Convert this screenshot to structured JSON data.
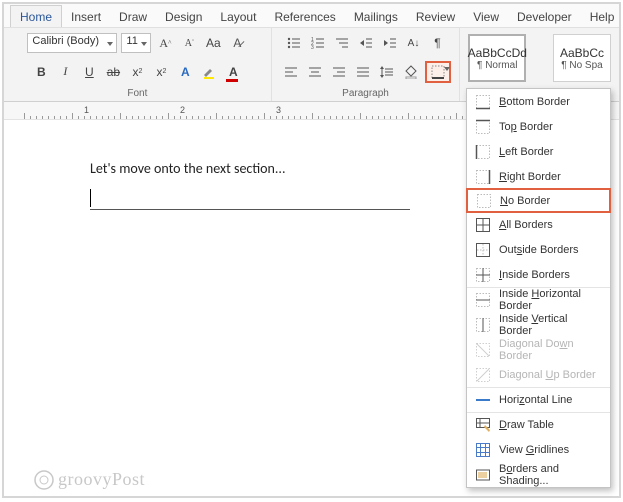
{
  "tabs": [
    "Home",
    "Insert",
    "Draw",
    "Design",
    "Layout",
    "References",
    "Mailings",
    "Review",
    "View",
    "Developer",
    "Help"
  ],
  "active_tab": 0,
  "font": {
    "name": "Calibri (Body)",
    "size": "11"
  },
  "groups": {
    "font_label": "Font",
    "paragraph_label": "Paragraph"
  },
  "styles": {
    "normal_preview": "AaBbCcDd",
    "normal_label": "¶ Normal",
    "nospace_preview": "AaBbCc",
    "nospace_label": "¶ No Spa"
  },
  "ruler": {
    "positions": [
      1,
      2,
      3
    ]
  },
  "document": {
    "text": "Let's move onto the next section..."
  },
  "border_menu": [
    {
      "label_pre": "",
      "u": "B",
      "label_post": "ottom Border",
      "icon": "bottom"
    },
    {
      "label_pre": "To",
      "u": "p",
      "label_post": " Border",
      "icon": "top"
    },
    {
      "label_pre": "",
      "u": "L",
      "label_post": "eft Border",
      "icon": "left"
    },
    {
      "label_pre": "",
      "u": "R",
      "label_post": "ight Border",
      "icon": "right"
    },
    {
      "label_pre": "",
      "u": "N",
      "label_post": "o Border",
      "icon": "none",
      "highlight": true,
      "sep": true
    },
    {
      "label_pre": "",
      "u": "A",
      "label_post": "ll Borders",
      "icon": "all"
    },
    {
      "label_pre": "Out",
      "u": "s",
      "label_post": "ide Borders",
      "icon": "outside"
    },
    {
      "label_pre": "",
      "u": "I",
      "label_post": "nside Borders",
      "icon": "inside"
    },
    {
      "label_pre": "Inside ",
      "u": "H",
      "label_post": "orizontal Border",
      "icon": "hmid",
      "sep": true
    },
    {
      "label_pre": "Inside ",
      "u": "V",
      "label_post": "ertical Border",
      "icon": "vmid"
    },
    {
      "label_pre": "Diagonal Do",
      "u": "w",
      "label_post": "n Border",
      "icon": "ddown",
      "disabled": true
    },
    {
      "label_pre": "Diagonal ",
      "u": "U",
      "label_post": "p Border",
      "icon": "dup",
      "disabled": true
    },
    {
      "label_pre": "Hori",
      "u": "z",
      "label_post": "ontal Line",
      "icon": "hline",
      "sep": true,
      "blue": true
    },
    {
      "label_pre": "",
      "u": "D",
      "label_post": "raw Table",
      "icon": "draw",
      "sep": true
    },
    {
      "label_pre": "View ",
      "u": "G",
      "label_post": "ridlines",
      "icon": "grid"
    },
    {
      "label_pre": "B",
      "u": "o",
      "label_post": "rders and Shading...",
      "icon": "shade"
    }
  ],
  "watermark": "groovyPost"
}
